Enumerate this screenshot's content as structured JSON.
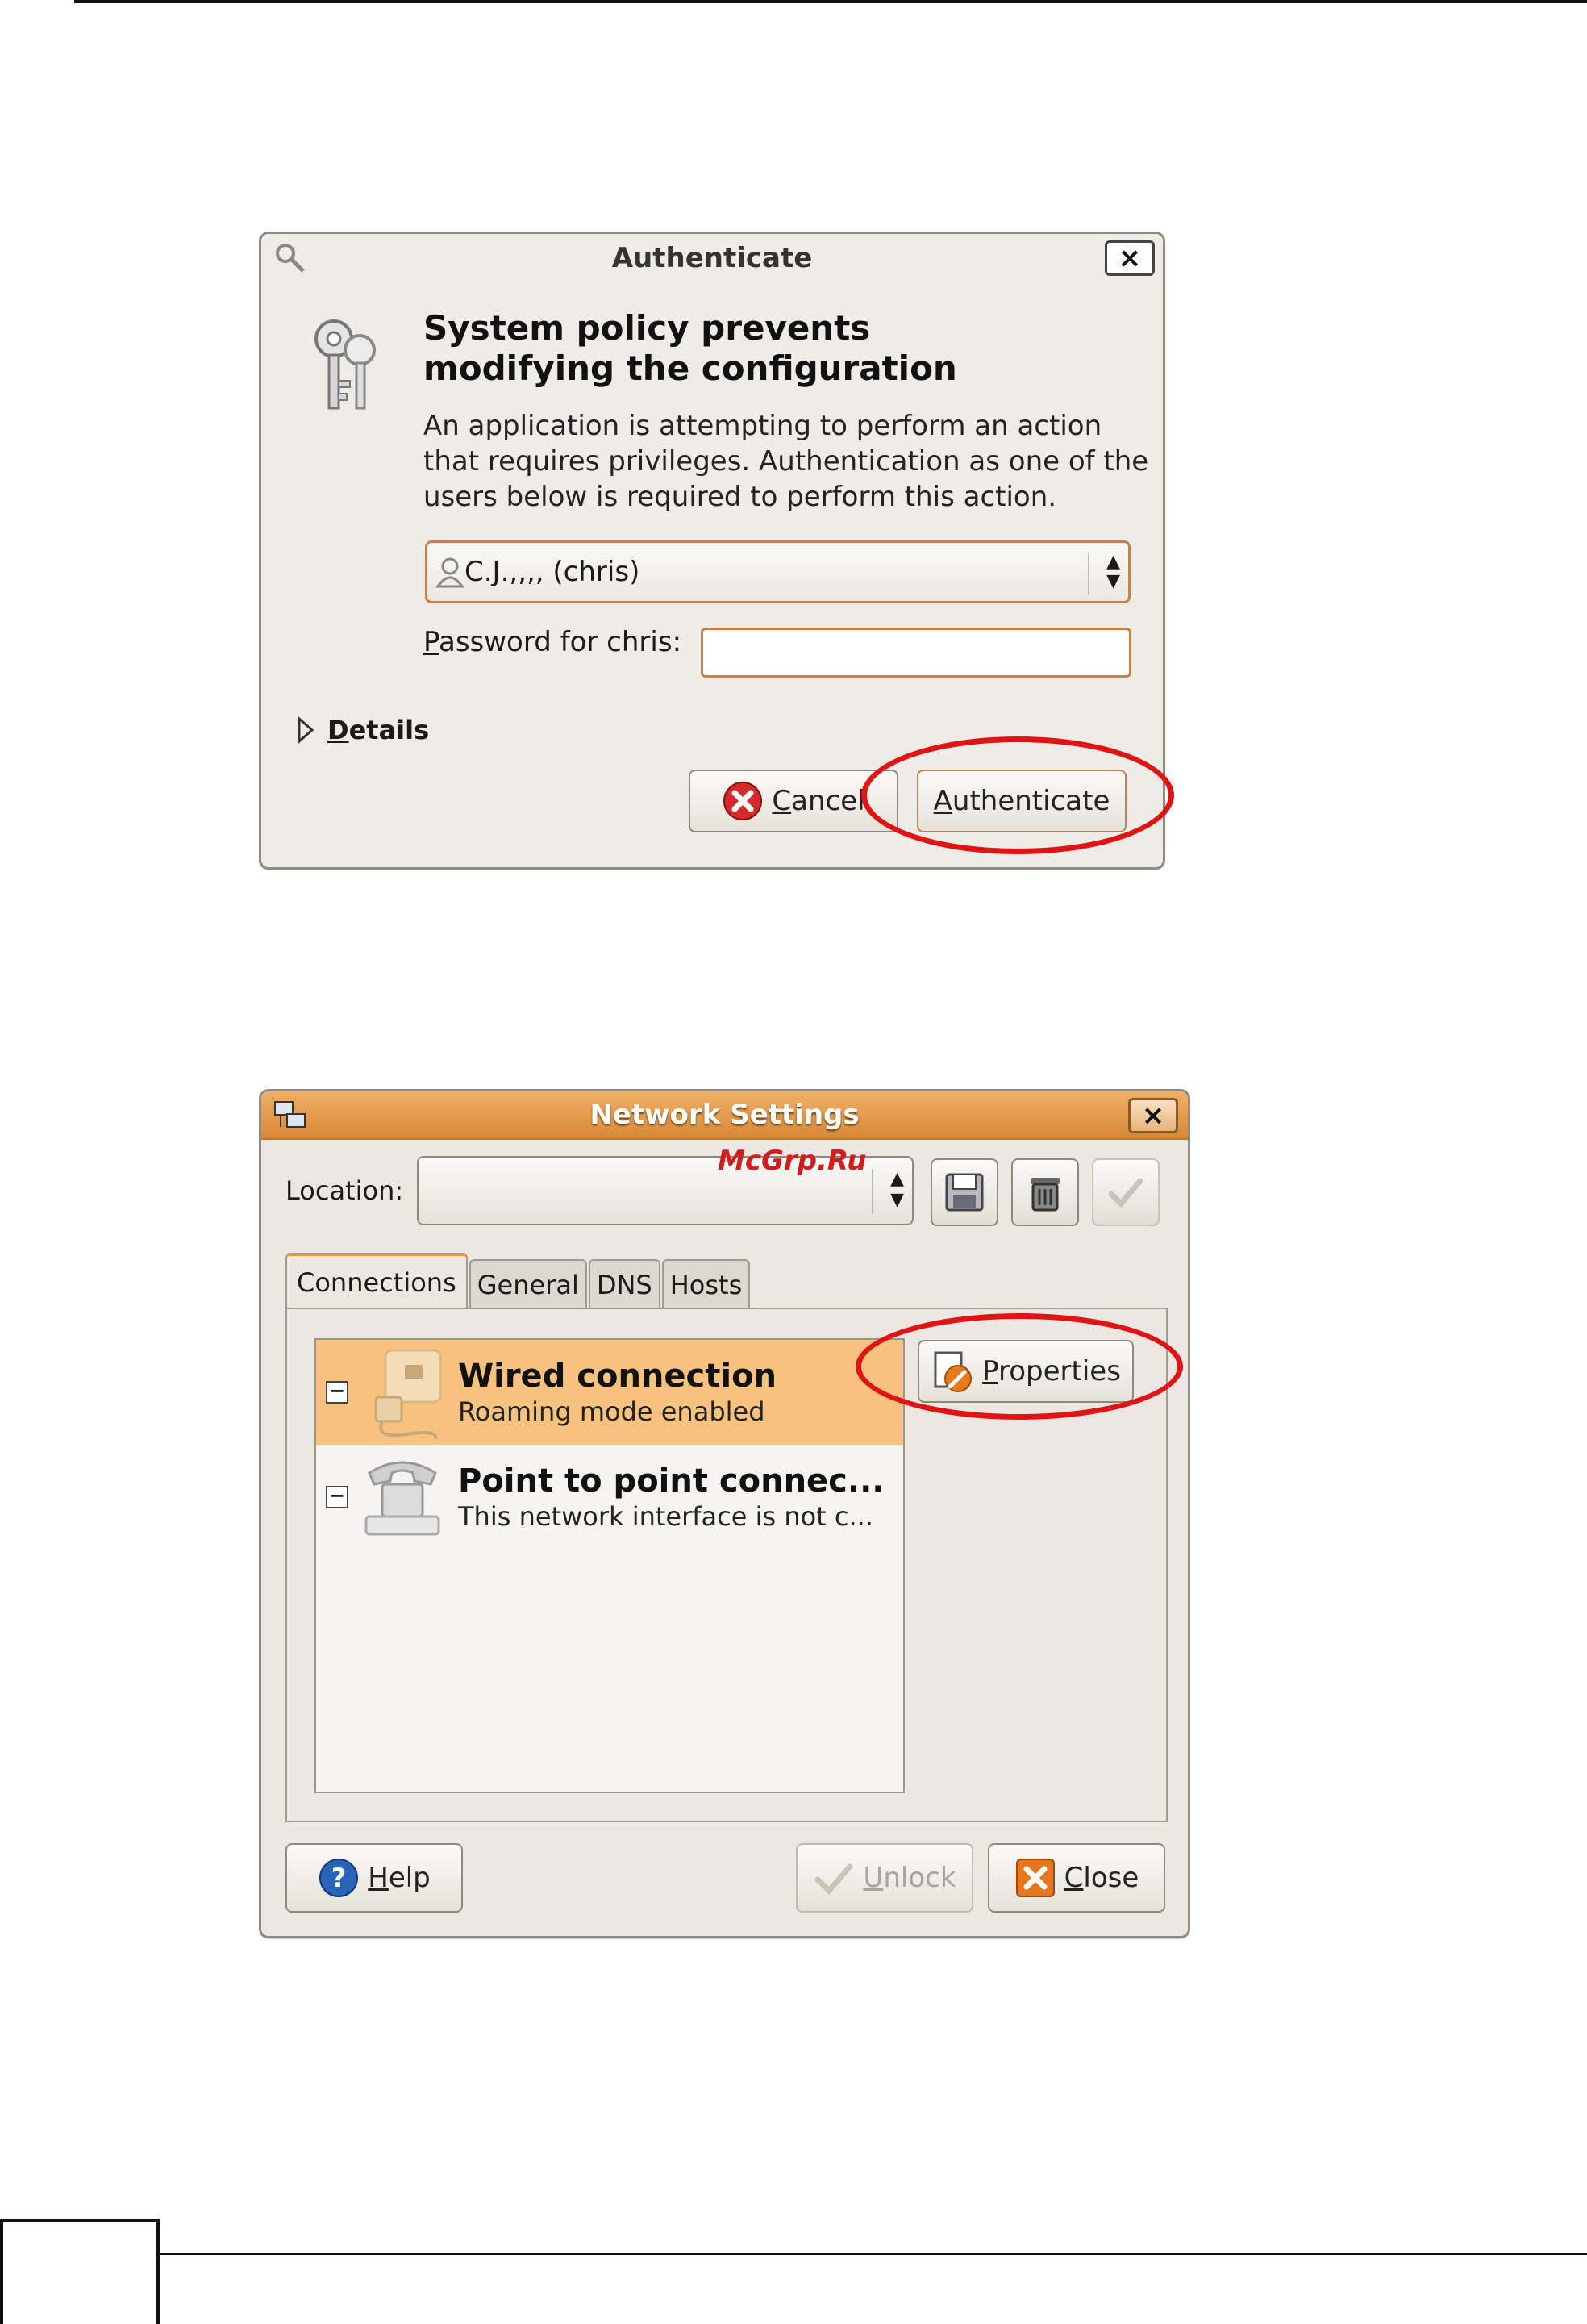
{
  "auth_dialog": {
    "title": "Authenticate",
    "close_glyph": "×",
    "heading_line1": "System policy prevents",
    "heading_line2": "modifying the configuration",
    "body_line1": "An application is attempting to perform an action",
    "body_line2": "that requires privileges. Authentication as one of the",
    "body_line3": "users below is required to perform this action.",
    "user_selected": "C.J.,,,, (chris)",
    "password_label_first": "P",
    "password_label_rest": "assword for chris:",
    "password_value": "",
    "details_first": "D",
    "details_rest": "etails",
    "cancel_first": "C",
    "cancel_rest": "ancel",
    "authenticate_first": "A",
    "authenticate_rest": "uthenticate"
  },
  "network_dialog": {
    "title": "Network Settings",
    "close_glyph": "×",
    "location_label": "Location:",
    "location_value": "",
    "watermark": "McGrp.Ru",
    "tabs": [
      "Connections",
      "General",
      "DNS",
      "Hosts"
    ],
    "active_tab": "Connections",
    "connections": [
      {
        "name": "Wired connection",
        "description": "Roaming mode enabled",
        "enabled_glyph": "−",
        "selected": true
      },
      {
        "name": "Point to point connec...",
        "description": "This network interface is not c...",
        "enabled_glyph": "−",
        "selected": false
      }
    ],
    "properties_first": "P",
    "properties_rest": "roperties",
    "help_first": "H",
    "help_rest": "elp",
    "unlock_first": "U",
    "unlock_rest": "nlock",
    "close_first": "C",
    "close_rest": "lose"
  },
  "colors": {
    "highlight_oval": "#e01414",
    "selected_row": "#f6c27e",
    "titlebar_orange": "#d88836",
    "watermark": "#d41c1c"
  },
  "icons": [
    "keys-icon",
    "user-icon",
    "expander-triangle-icon",
    "cancel-x-icon",
    "wrench-doc-icon",
    "save-icon",
    "trash-icon",
    "check-icon",
    "help-icon",
    "close-x-icon",
    "network-icon",
    "ethernet-icon",
    "telephone-icon"
  ]
}
